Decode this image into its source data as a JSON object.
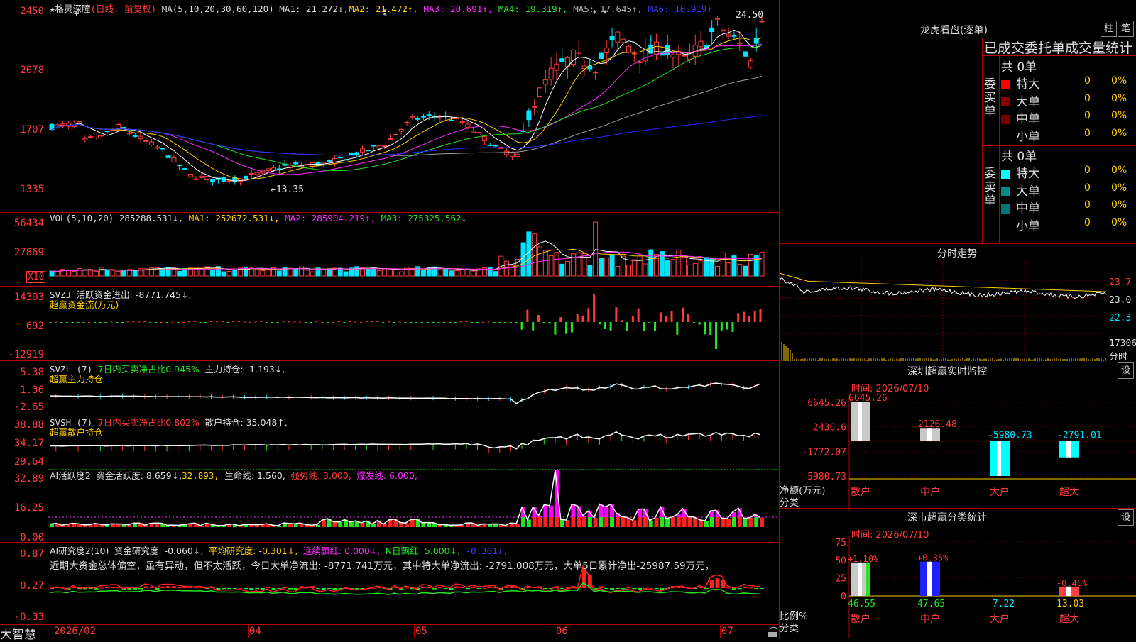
{
  "brand": "大智慧",
  "main": {
    "legend": {
      "star": "★",
      "stock_name": "格灵深瞳",
      "mode": "(日线, 前复权)",
      "ma_def": "MA(5,10,20,30,60,120)",
      "ma1": "MA1: 21.272↓,",
      "ma2": "MA2: 21.472↑,",
      "ma3": "MA3: 20.691↑,",
      "ma4": "MA4: 19.319↑,",
      "ma5": "MA5: 17.645↑,",
      "ma6": "MA6: 16.919↑"
    },
    "yaxis": [
      "2450",
      "2078",
      "1707",
      "1335"
    ],
    "high_label": "24.50",
    "low_label": "←13.35",
    "markers": [
      "+",
      "+",
      "⁑",
      "* *"
    ]
  },
  "vol": {
    "legend": {
      "def": "VOL(5,10,20)",
      "v": "285288.531↓,",
      "ma1": "MA1: 252672.531↓,",
      "ma2": "MA2: 285904.219↑,",
      "ma3": "MA3: 275325.562↓"
    },
    "yaxis": [
      "56434",
      "27869"
    ],
    "unit_box": "X10"
  },
  "svzj": {
    "legend": {
      "name": "SVZJ",
      "text": "活跃资金进出: -8771.745↓,"
    },
    "title": "超赢资金流(万元)",
    "yaxis": [
      "14303",
      "692",
      "-12919"
    ]
  },
  "svzl": {
    "legend": {
      "name": "SVZL (7)",
      "text1": "7日内买卖净占比0.945%",
      "text2": "主力持仓: -1.193↓,"
    },
    "title": "超赢主力持仓",
    "yaxis": [
      "5.38",
      "1.36",
      "-2.65"
    ]
  },
  "svsh": {
    "legend": {
      "name": "SVSH (7)",
      "text1": "7日内买卖净占比0.802%",
      "text2": "散户持仓: 35.048↑,"
    },
    "title": "超赢散户持仓",
    "yaxis": [
      "38.88",
      "34.17",
      "29.64"
    ]
  },
  "ai1": {
    "legend": {
      "name": "AI活跃度2",
      "a": "资金活跃度: 8.659↓,",
      "b": "32.893,",
      "c": "生命线: 1.560,",
      "d": "强势线: 3.000,",
      "e": "爆发线: 6.000,"
    },
    "yaxis": [
      "32.89",
      "16.25",
      "0.00"
    ]
  },
  "ai2": {
    "legend": {
      "name": "AI研究度2(10)",
      "a": "资金研究度: -0.060↓,",
      "b": "平均研究度: -0.301↓,",
      "c": "连续飘红: 0.000↓,",
      "d": "N日飘红: 5.000↓,",
      "e": "-0.301↓,"
    },
    "comment": "近期大资金总体偏空，虽有异动，但不太活跃，今日大单净流出: -8771.741万元，其中特大单净流出: -2791.008万元，大单5日累计净出-25987.59万元，",
    "yaxis": [
      "0.87",
      "0.27",
      "-0.33"
    ]
  },
  "xaxis": [
    "2026/02",
    "04",
    "05",
    "06",
    "07"
  ],
  "right": {
    "lhb": {
      "title": "龙虎看盘(逐单)",
      "btn1": "柱",
      "btn2": "笔",
      "subtitle": "已成交委托单成交量统计"
    },
    "buy": {
      "side": "委买单",
      "total": "共 0单",
      "rows": [
        {
          "label": "特大",
          "count": "0",
          "pct": "0%",
          "color": "#ff0000"
        },
        {
          "label": "大单",
          "count": "0",
          "pct": "0%",
          "color": "#8b0000"
        },
        {
          "label": "中单",
          "count": "0",
          "pct": "0%",
          "color": "#7a0000"
        },
        {
          "label": "小单",
          "count": "0",
          "pct": "0%",
          "color": "#000000"
        }
      ]
    },
    "sell": {
      "side": "委卖单",
      "total": "共 0单",
      "rows": [
        {
          "label": "特大",
          "count": "0",
          "pct": "0%",
          "color": "#00ffff"
        },
        {
          "label": "大单",
          "count": "0",
          "pct": "0%",
          "color": "#008b8b"
        },
        {
          "label": "中单",
          "count": "0",
          "pct": "0%",
          "color": "#007777"
        },
        {
          "label": "小单",
          "count": "0",
          "pct": "0%",
          "color": "#000000"
        }
      ]
    },
    "intraday": {
      "title": "分时走势",
      "p1": "23.7",
      "p2": "23.0",
      "p3": "22.3",
      "vol": "17306",
      "unit": "分时"
    },
    "monitor": {
      "title": "深圳超赢实时监控",
      "btn": "设",
      "time": "时间: 2026/07/10",
      "yaxis": [
        "6645.26",
        "2436.6",
        "-1772.07",
        "-5980.73"
      ],
      "ylabel1": "净额(万元)",
      "ylabel2": "分类",
      "bars": [
        {
          "cat": "散户",
          "value": "6645.26"
        },
        {
          "cat": "中户",
          "value": "2126.48"
        },
        {
          "cat": "大户",
          "value": "-5980.73"
        },
        {
          "cat": "超大",
          "value": "-2791.01"
        }
      ]
    },
    "classify": {
      "title": "深市超赢分类统计",
      "btn": "设",
      "time": "时间: 2026/07/10",
      "yaxis": [
        "75",
        "50",
        "25",
        "0"
      ],
      "ylabel1": "比例%",
      "ylabel2": "分类",
      "bars": [
        {
          "cat": "散户",
          "top": "+1.10%",
          "bottom": "46.55"
        },
        {
          "cat": "中户",
          "top": "+0.35%",
          "bottom": "47.65"
        },
        {
          "cat": "大户",
          "top": "",
          "bottom": "-7.22"
        },
        {
          "cat": "超大",
          "top": "-0.46%",
          "bottom": "13.03"
        }
      ]
    }
  },
  "colors": {
    "up": "#ff3b3b",
    "down": "#00e5ff",
    "grid": "#b40000",
    "ma_white": "#ffffff",
    "ma_yellow": "#ffd000",
    "ma_magenta": "#ff2cff",
    "ma_green": "#21e621",
    "ma_gray": "#a0a0a0",
    "ma_blue": "#2828ff"
  }
}
